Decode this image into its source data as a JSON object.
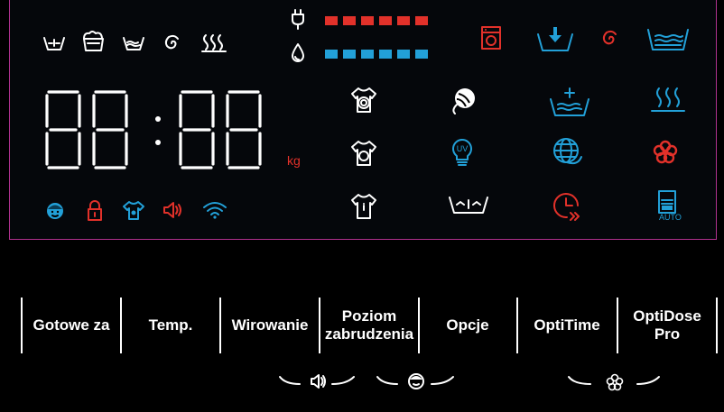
{
  "display": {
    "time_digits": "88:88",
    "weight_unit": "kg",
    "auto_label": "AUTO"
  },
  "colors": {
    "white": "#ffffff",
    "red": "#e2312a",
    "blue": "#22a0d8",
    "border": "#b0318e"
  },
  "level_bars": {
    "temperature_segments": 6,
    "water_segments": 6
  },
  "top_row_icons": [
    "basin-icon",
    "soil-level-icon",
    "rinse-basin-icon",
    "spin-spiral-icon",
    "steam-icon"
  ],
  "status_icons": [
    "child-lock-face-icon",
    "door-lock-icon",
    "shirt-icon",
    "sound-icon",
    "wifi-icon"
  ],
  "buttons": [
    {
      "label": "Gotowe za"
    },
    {
      "label": "Temp."
    },
    {
      "label": "Wirowanie"
    },
    {
      "label": "Poziom zabrudzenia"
    },
    {
      "label": "Opcje"
    },
    {
      "label": "OptiTime"
    },
    {
      "label": "OptiDose Pro"
    }
  ],
  "combo_icons": [
    "sound-combo-icon",
    "child-lock-combo-icon",
    "flower-combo-icon"
  ]
}
